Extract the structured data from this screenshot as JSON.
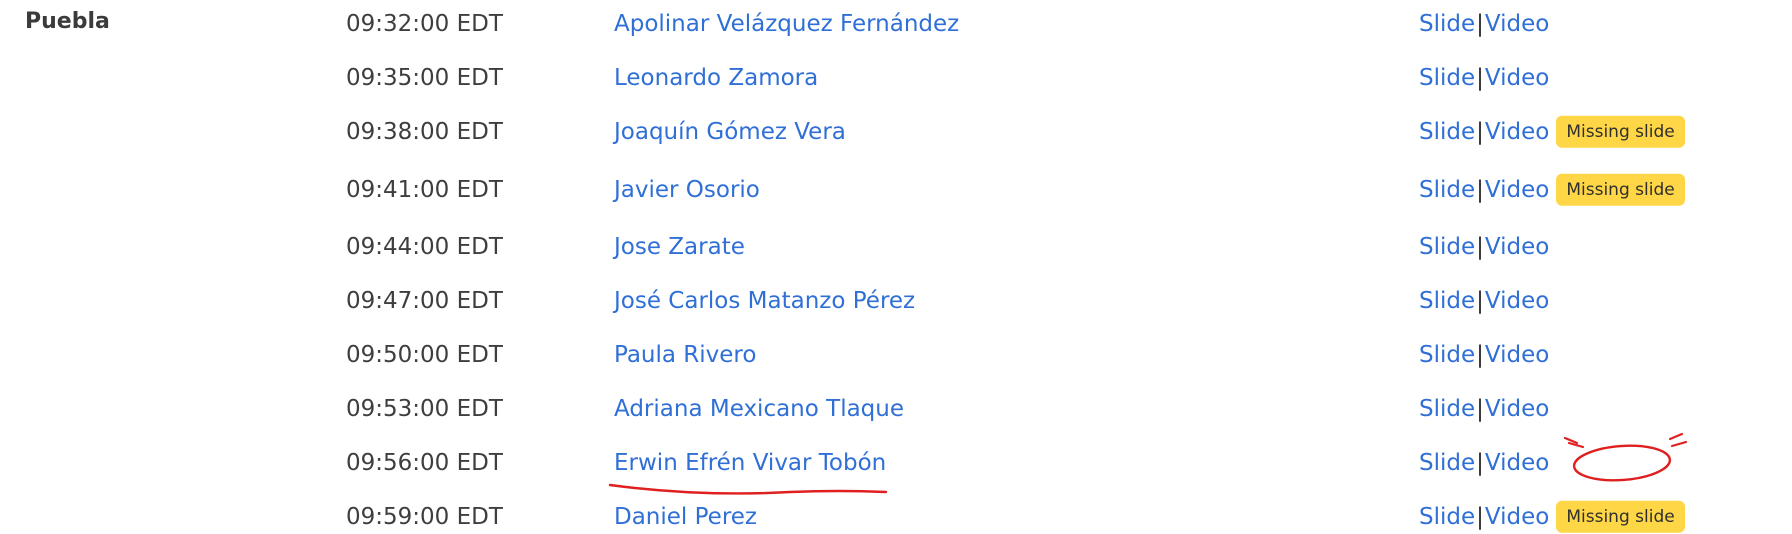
{
  "venue": "Puebla",
  "slide_label": "Slide",
  "separator": "|",
  "video_label": "Video",
  "missing_label": "Missing slide",
  "rows": [
    {
      "time": "09:32:00 EDT",
      "speaker": "Apolinar Velázquez Fernández",
      "missing": false
    },
    {
      "time": "09:35:00 EDT",
      "speaker": "Leonardo Zamora",
      "missing": false
    },
    {
      "time": "09:38:00 EDT",
      "speaker": "Joaquín Gómez Vera",
      "missing": true
    },
    {
      "time": "09:41:00 EDT",
      "speaker": "Javier Osorio",
      "missing": true
    },
    {
      "time": "09:44:00 EDT",
      "speaker": "Jose Zarate",
      "missing": false
    },
    {
      "time": "09:47:00 EDT",
      "speaker": "José Carlos Matanzo Pérez",
      "missing": false
    },
    {
      "time": "09:50:00 EDT",
      "speaker": "Paula Rivero",
      "missing": false
    },
    {
      "time": "09:53:00 EDT",
      "speaker": "Adriana Mexicano Tlaque",
      "missing": false
    },
    {
      "time": "09:56:00 EDT",
      "speaker": "Erwin Efrén Vivar Tobón",
      "missing": false
    },
    {
      "time": "09:59:00 EDT",
      "speaker": "Daniel Perez",
      "missing": true
    }
  ],
  "annotation_color": "#e02020"
}
